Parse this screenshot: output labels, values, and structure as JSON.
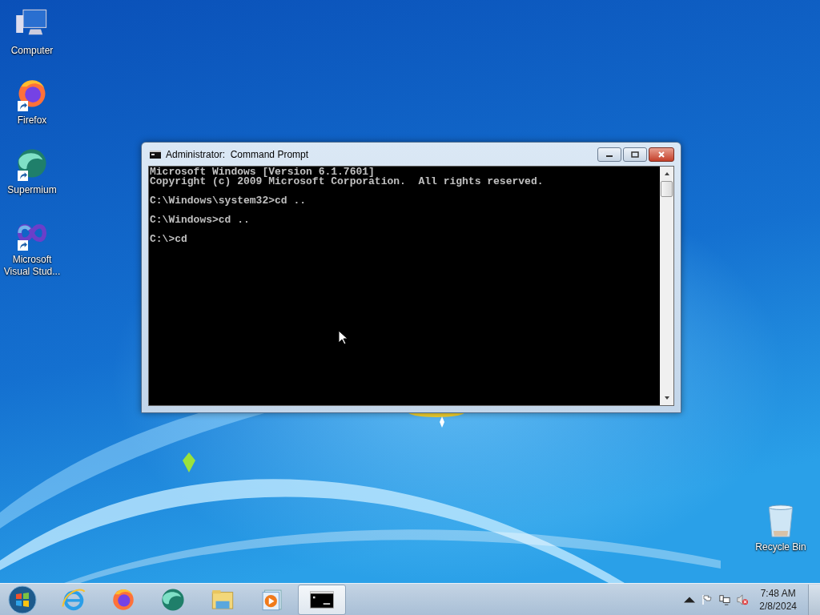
{
  "desktop_icons": [
    {
      "label": "Computer",
      "kind": "computer",
      "shortcut": false
    },
    {
      "label": "Firefox",
      "kind": "firefox",
      "shortcut": true
    },
    {
      "label": "Supermium",
      "kind": "supermium",
      "shortcut": true
    },
    {
      "label": "Microsoft Visual Stud...",
      "kind": "visual-studio",
      "shortcut": true
    }
  ],
  "recycle_bin": {
    "label": "Recycle Bin"
  },
  "window": {
    "title": "Administrator:  Command Prompt",
    "console_blocks": [
      [
        "Microsoft Windows [Version 6.1.7601]",
        "Copyright (c) 2009 Microsoft Corporation.  All rights reserved."
      ],
      [
        "C:\\Windows\\system32>cd .."
      ],
      [
        "C:\\Windows>cd .."
      ],
      [
        "C:\\>cd"
      ]
    ]
  },
  "taskbar": {
    "apps": [
      {
        "kind": "ie",
        "selected": false
      },
      {
        "kind": "firefox",
        "selected": false
      },
      {
        "kind": "supermium",
        "selected": false
      },
      {
        "kind": "explorer",
        "selected": false
      },
      {
        "kind": "media-player",
        "selected": false
      },
      {
        "kind": "cmd",
        "selected": true
      }
    ],
    "tray": {
      "volume_muted": true,
      "time": "7:48 AM",
      "date": "2/8/2024"
    }
  }
}
